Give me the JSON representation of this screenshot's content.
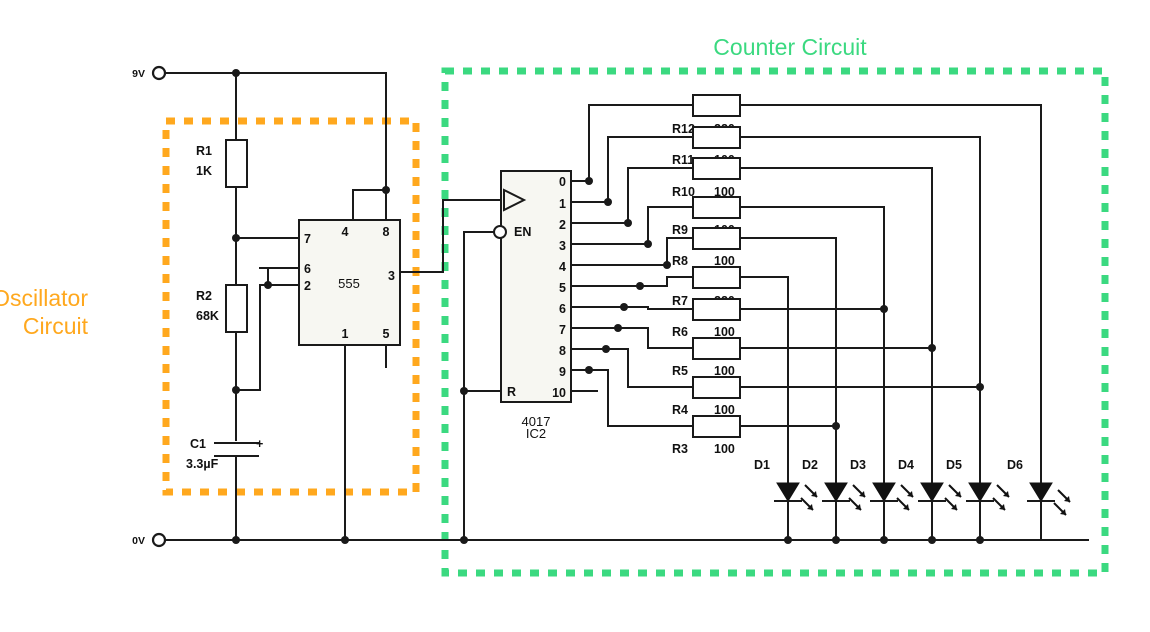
{
  "diagram": {
    "title_oscillator": "Oscillator\nCircuit",
    "title_oscillator_line1": "Oscillator",
    "title_oscillator_line2": "Circuit",
    "title_counter": "Counter Circuit",
    "colors": {
      "oscillator_group": "#FFA81E",
      "counter_group": "#3BD980",
      "wire": "#1a1a1a",
      "ic_fill": "#f7f7f2",
      "background": "#ffffff"
    }
  },
  "rails": {
    "positive": "9V",
    "ground": "0V"
  },
  "oscillator": {
    "ic": {
      "name": "555",
      "pins": {
        "p1": "1",
        "p2": "2",
        "p3": "3",
        "p4": "4",
        "p5": "5",
        "p6": "6",
        "p7": "7",
        "p8": "8"
      }
    },
    "components": [
      {
        "ref": "R1",
        "value": "1K"
      },
      {
        "ref": "R2",
        "value": "68K"
      },
      {
        "ref": "C1",
        "value": "3.3µF",
        "polarity": "+"
      }
    ]
  },
  "counter": {
    "ic": {
      "name": "4017",
      "designator": "IC2",
      "enable_label": "EN",
      "reset_label": "R",
      "output_pins": [
        "0",
        "1",
        "2",
        "3",
        "4",
        "5",
        "6",
        "7",
        "8",
        "9",
        "10"
      ]
    },
    "resistors": [
      {
        "ref": "R12",
        "value": "220"
      },
      {
        "ref": "R11",
        "value": "100"
      },
      {
        "ref": "R10",
        "value": "100"
      },
      {
        "ref": "R9",
        "value": "100"
      },
      {
        "ref": "R8",
        "value": "100"
      },
      {
        "ref": "R7",
        "value": "220"
      },
      {
        "ref": "R6",
        "value": "100"
      },
      {
        "ref": "R5",
        "value": "100"
      },
      {
        "ref": "R4",
        "value": "100"
      },
      {
        "ref": "R3",
        "value": "100"
      }
    ],
    "leds": [
      {
        "ref": "D1"
      },
      {
        "ref": "D2"
      },
      {
        "ref": "D3"
      },
      {
        "ref": "D4"
      },
      {
        "ref": "D5"
      },
      {
        "ref": "D6"
      }
    ]
  }
}
